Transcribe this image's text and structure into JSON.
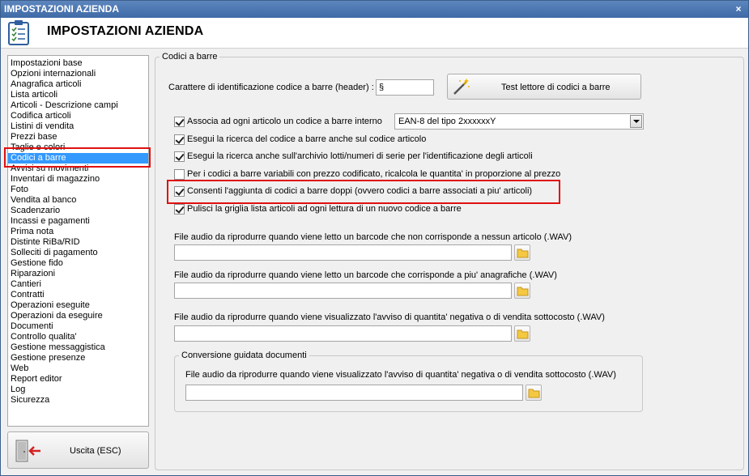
{
  "window": {
    "title": "IMPOSTAZIONI AZIENDA",
    "close_glyph": "×"
  },
  "header": {
    "title": "IMPOSTAZIONI AZIENDA",
    "icon": "clipboard-checklist-icon"
  },
  "nav": {
    "items": [
      "Impostazioni base",
      "Opzioni internazionali",
      "Anagrafica articoli",
      "Lista articoli",
      "Articoli - Descrizione campi",
      "Codifica articoli",
      "Listini di vendita",
      "Prezzi base",
      "Taglie e colori",
      "Codici a barre",
      "Avvisi su movimenti",
      "Inventari di magazzino",
      "Foto",
      "Vendita al banco",
      "Scadenzario",
      "Incassi e pagamenti",
      "Prima nota",
      "Distinte RiBa/RID",
      "Solleciti di pagamento",
      "Gestione fido",
      "Riparazioni",
      "Cantieri",
      "Contratti",
      "Operazioni eseguite",
      "Operazioni da eseguire",
      "Documenti",
      "Controllo qualita'",
      "Gestione messaggistica",
      "Gestione presenze",
      "Web",
      "Report editor",
      "Log",
      "Sicurezza"
    ],
    "selected": "Codici a barre"
  },
  "exit_button": {
    "label": "Uscita (ESC)",
    "icon": "exit-door-icon"
  },
  "panel": {
    "group_title": "Codici a barre",
    "header_char": {
      "label": "Carattere di identificazione codice a barre (header) :",
      "value": "§"
    },
    "test_button": {
      "label": "Test lettore di codici a barre",
      "icon": "barcode-wand-icon"
    },
    "checks": [
      {
        "label": "Associa ad ogni articolo un codice a barre interno",
        "checked": true
      },
      {
        "label": "Esegui la ricerca del codice a barre anche sul codice articolo",
        "checked": true
      },
      {
        "label": "Esegui la ricerca anche sull'archivio lotti/numeri di serie per l'identificazione degli articoli",
        "checked": true
      },
      {
        "label": "Per i codici a barre variabili con prezzo codificato, ricalcola le quantita' in proporzione al prezzo",
        "checked": false
      },
      {
        "label": "Consenti l'aggiunta di codici a barre doppi (ovvero codici a barre associati a piu' articoli)",
        "checked": true
      },
      {
        "label": "Pulisci la griglia lista articoli ad ogni lettura di un nuovo codice a barre",
        "checked": true
      }
    ],
    "barcode_type": {
      "selected": "EAN-8 del tipo 2xxxxxxY"
    },
    "audio_files": [
      {
        "label": "File audio da riprodurre quando viene letto un barcode che non corrisponde a nessun articolo (.WAV)",
        "value": ""
      },
      {
        "label": "File audio da riprodurre quando viene letto un barcode che corrisponde a piu' anagrafiche (.WAV)",
        "value": ""
      },
      {
        "label": "File audio da riprodurre quando viene visualizzato l'avviso di quantita' negativa o di vendita sottocosto (.WAV)",
        "value": ""
      }
    ],
    "conversion_group": {
      "title": "Conversione guidata documenti",
      "audio_label": "File audio da riprodurre quando viene visualizzato l'avviso di quantita' negativa o di vendita sottocosto (.WAV)",
      "audio_value": ""
    }
  },
  "colors": {
    "titlebar": "#4a74ae",
    "selection": "#3399ff",
    "highlight_box": "#e01010"
  }
}
